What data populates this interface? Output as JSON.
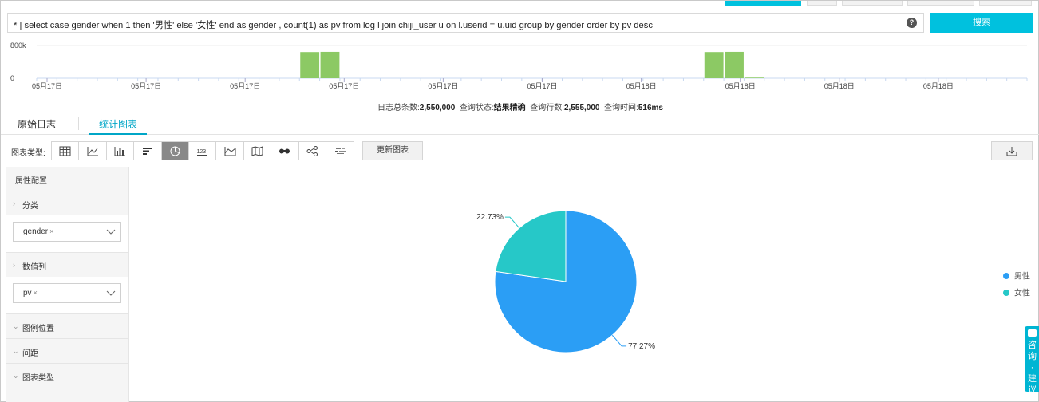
{
  "query": {
    "text": "* | select  case gender  when 1 then '男性'  else  '女性'  end as gender , count(1) as pv   from log l join chiji_user u on l.userid = u.uid  group by gender   order by pv desc",
    "help_glyph": "?",
    "search_label": "搜索"
  },
  "histogram": {
    "y_labels": [
      "800k",
      "0"
    ],
    "x_labels": [
      "05月17日",
      "05月17日",
      "05月17日",
      "05月17日",
      "05月17日",
      "05月17日",
      "05月18日",
      "05月18日",
      "05月18日",
      "05月18日"
    ],
    "bars": [
      {
        "slot": 13,
        "value": 640000
      },
      {
        "slot": 14,
        "value": 645000
      },
      {
        "slot": 33,
        "value": 640000
      },
      {
        "slot": 34,
        "value": 645000
      },
      {
        "slot": 35,
        "value": 15000
      }
    ],
    "ymax": 800000,
    "bar_color": "#8cc964"
  },
  "summary": {
    "total_label": "日志总条数:",
    "total_value": "2,550,000",
    "status_label": "查询状态:",
    "status_value": "结果精确",
    "rows_label": "查询行数:",
    "rows_value": "2,555,000",
    "time_label": "查询时间:",
    "time_value": "516ms"
  },
  "tabs": [
    {
      "label": "原始日志"
    },
    {
      "label": "统计图表"
    }
  ],
  "toolbar": {
    "label": "图表类型:",
    "update_label": "更新图表",
    "types": [
      "table-icon",
      "line-chart-icon",
      "bar-chart-icon",
      "horizontal-bar-icon",
      "pie-chart-icon",
      "number-icon",
      "area-chart-icon",
      "map-icon",
      "flow-icon",
      "topology-icon",
      "word-cloud-icon"
    ],
    "number_glyph": "123"
  },
  "panel": {
    "title": "属性配置",
    "category_label": "分类",
    "category_value": "gender",
    "value_label": "数值列",
    "value_value": "pv",
    "legend_pos_label": "图例位置",
    "spacing_label": "间距",
    "chart_type_label": "图表类型",
    "tag_remove": "×"
  },
  "chart_data": {
    "type": "pie",
    "categories": [
      "男性",
      "女性"
    ],
    "values": [
      77.27,
      22.73
    ],
    "labels": [
      "77.27%",
      "22.73%"
    ],
    "colors": [
      "#2b9ef5",
      "#26c8c8"
    ],
    "legend": "right"
  },
  "consult": {
    "text": "咨询·建议"
  }
}
